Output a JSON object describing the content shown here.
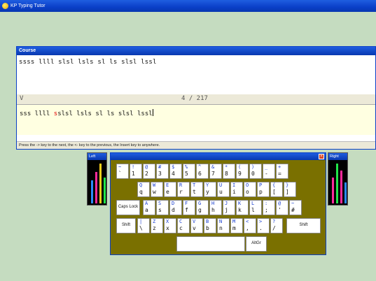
{
  "window": {
    "title": "KP Typing Tutor"
  },
  "course": {
    "title": "Course",
    "lesson_text": "ssss llll slsl lsls sl ls slsl lssl",
    "status_letter": "V",
    "progress": "4 / 217",
    "typed_before_error": "sss llll ",
    "typed_error_char": "s",
    "typed_after_error": "slsl lsls sl ls slsl lssl",
    "hint": "Press the -> key to the next, the <- key to the previous, the Insert key to anywhere."
  },
  "left_hand": {
    "title": "Left",
    "bar_colors": [
      "#2a8cff",
      "#ff2a9a",
      "#ffd21a",
      "#21e64a"
    ],
    "bar_levels": [
      0.55,
      0.75,
      0.95,
      0.62
    ]
  },
  "right_hand": {
    "title": "Right",
    "bar_colors": [
      "#ff2a9a",
      "#21e64a",
      "#ff2a9a",
      "#2a8cff"
    ],
    "bar_levels": [
      0.62,
      0.95,
      0.78,
      0.5
    ]
  },
  "keyboard": {
    "close_icon": "close-icon",
    "rows": [
      {
        "keys": [
          {
            "up": "~",
            "lo": "`"
          },
          {
            "up": "!",
            "lo": "1"
          },
          {
            "up": "@",
            "lo": "2"
          },
          {
            "up": "#",
            "lo": "3"
          },
          {
            "up": "$",
            "lo": "4"
          },
          {
            "up": "%",
            "lo": "5"
          },
          {
            "up": "^",
            "lo": "6"
          },
          {
            "up": "&",
            "lo": "7"
          },
          {
            "up": "*",
            "lo": "8"
          },
          {
            "up": "(",
            "lo": "9"
          },
          {
            "up": ")",
            "lo": "0"
          },
          {
            "up": "_",
            "lo": "-"
          },
          {
            "up": "+",
            "lo": "="
          }
        ]
      },
      {
        "keys": [
          {
            "up": "Q",
            "lo": "q"
          },
          {
            "up": "W",
            "lo": "w"
          },
          {
            "up": "E",
            "lo": "e"
          },
          {
            "up": "R",
            "lo": "r"
          },
          {
            "up": "T",
            "lo": "t"
          },
          {
            "up": "Y",
            "lo": "y"
          },
          {
            "up": "U",
            "lo": "u"
          },
          {
            "up": "I",
            "lo": "i"
          },
          {
            "up": "O",
            "lo": "o"
          },
          {
            "up": "P",
            "lo": "p"
          },
          {
            "up": "{",
            "lo": "["
          },
          {
            "up": "}",
            "lo": "]"
          }
        ]
      },
      {
        "special": "Caps Lock",
        "keys": [
          {
            "up": "A",
            "lo": "a"
          },
          {
            "up": "S",
            "lo": "s"
          },
          {
            "up": "D",
            "lo": "d"
          },
          {
            "up": "F",
            "lo": "f"
          },
          {
            "up": "G",
            "lo": "g"
          },
          {
            "up": "H",
            "lo": "h"
          },
          {
            "up": "J",
            "lo": "j"
          },
          {
            "up": "K",
            "lo": "k"
          },
          {
            "up": "L",
            "lo": "l"
          },
          {
            "up": ":",
            "lo": ";"
          },
          {
            "up": "@",
            "lo": "'"
          },
          {
            "up": "~",
            "lo": "#"
          }
        ]
      },
      {
        "special": "Shift",
        "special_right": "Shift",
        "keys": [
          {
            "up": "|",
            "lo": "\\"
          },
          {
            "up": "Z",
            "lo": "z"
          },
          {
            "up": "X",
            "lo": "x"
          },
          {
            "up": "C",
            "lo": "c"
          },
          {
            "up": "V",
            "lo": "v"
          },
          {
            "up": "B",
            "lo": "b"
          },
          {
            "up": "N",
            "lo": "n"
          },
          {
            "up": "M",
            "lo": "m"
          },
          {
            "up": "<",
            "lo": ","
          },
          {
            "up": ">",
            "lo": "."
          },
          {
            "up": "?",
            "lo": "/"
          }
        ]
      }
    ],
    "altgr": "AltGr"
  }
}
